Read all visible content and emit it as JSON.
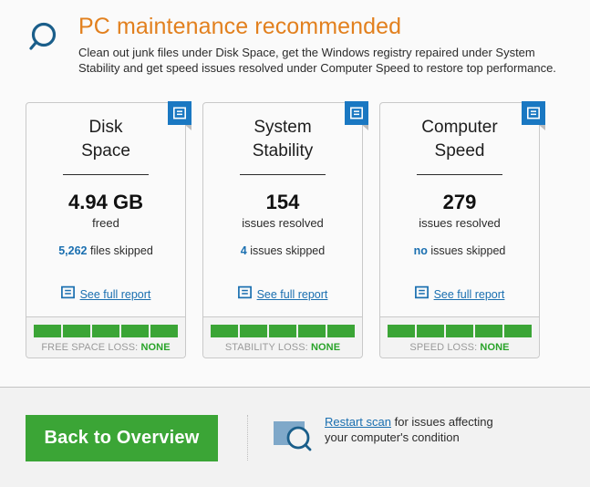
{
  "header": {
    "icon": "magnifier-icon",
    "title": "PC maintenance recommended",
    "description": "Clean out junk files under Disk Space, get the Windows registry repaired under System Stability and get speed issues resolved under Computer Speed to restore top performance.",
    "title_color": "#e2801e"
  },
  "cards": [
    {
      "title": "Disk\nSpace",
      "badge_icon": "report-badge-icon",
      "metric": "4.94 GB",
      "metric_sub": "freed",
      "skipped_value": "5,262",
      "skipped_text": "files skipped",
      "report_link": "See full report",
      "report_icon": "report-icon",
      "bars_filled": 5,
      "bars_total": 5,
      "footer_label": "FREE SPACE LOSS:",
      "footer_status": "NONE",
      "status_color": "#29a329"
    },
    {
      "title": "System\nStability",
      "badge_icon": "report-badge-icon",
      "metric": "154",
      "metric_sub": "issues resolved",
      "skipped_value": "4",
      "skipped_text": "issues skipped",
      "report_link": "See full report",
      "report_icon": "report-icon",
      "bars_filled": 5,
      "bars_total": 5,
      "footer_label": "STABILITY LOSS:",
      "footer_status": "NONE",
      "status_color": "#29a329"
    },
    {
      "title": "Computer\nSpeed",
      "badge_icon": "report-badge-icon",
      "metric": "279",
      "metric_sub": "issues resolved",
      "skipped_value": "no",
      "skipped_text": "issues skipped",
      "report_link": "See full report",
      "report_icon": "report-icon",
      "bars_filled": 5,
      "bars_total": 5,
      "footer_label": "SPEED LOSS:",
      "footer_status": "NONE",
      "status_color": "#29a329"
    }
  ],
  "footer": {
    "back_button": "Back to Overview",
    "back_button_color": "#3ba536",
    "rescan_icon": "screen-scan-icon",
    "rescan_link": "Restart scan",
    "rescan_rest": " for issues affecting your computer's condition"
  }
}
